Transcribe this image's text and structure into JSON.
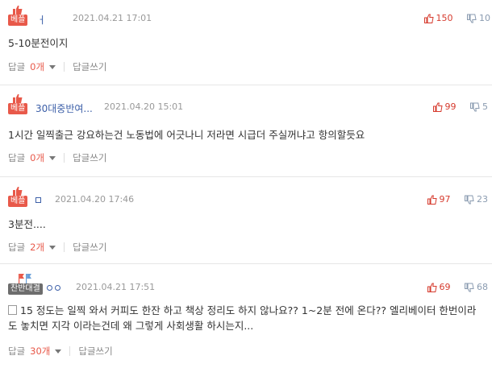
{
  "comments": [
    {
      "badge": "베플",
      "nickname": "ㅓ",
      "date": "2021.04.21 17:01",
      "upvotes": "150",
      "downvotes": "10",
      "text": "5-10분전이지",
      "reply_label": "답글",
      "reply_count": "0개",
      "reply_write": "답글쓰기"
    },
    {
      "badge": "베플",
      "nickname": "30대중반여...",
      "date": "2021.04.20 15:01",
      "upvotes": "99",
      "downvotes": "5",
      "text": "1시간 일찍출근 강요하는건 노동법에 어긋나니 저라면 시급더 주실꺼냐고 항의할듯요",
      "reply_label": "답글",
      "reply_count": "0개",
      "reply_write": "답글쓰기"
    },
    {
      "badge": "베플",
      "nickname": "ㅁ",
      "date": "2021.04.20 17:46",
      "upvotes": "97",
      "downvotes": "23",
      "text": "3분전....",
      "reply_label": "답글",
      "reply_count": "2개",
      "reply_write": "답글쓰기"
    },
    {
      "badge": "찬반대결",
      "nickname": "ㅇㅇ",
      "date": "2021.04.21 17:51",
      "upvotes": "69",
      "downvotes": "68",
      "text": "15 정도는 일찍 와서 커피도 한잔 하고 책상 정리도 하지 않나요?? 1~2분 전에 온다?? 엘리베이터 한번이라도 놓치면 지각 이라는건데 왜 그렇게 사회생활 하시는지...",
      "reply_label": "답글",
      "reply_count": "30개",
      "reply_write": "답글쓰기"
    }
  ],
  "colors": {
    "badge_red": "#e8594a",
    "badge_gray": "#6d6d6d",
    "upvote": "#d63b2e",
    "downvote": "#8a9bb0",
    "nickname": "#3c5fa8"
  }
}
